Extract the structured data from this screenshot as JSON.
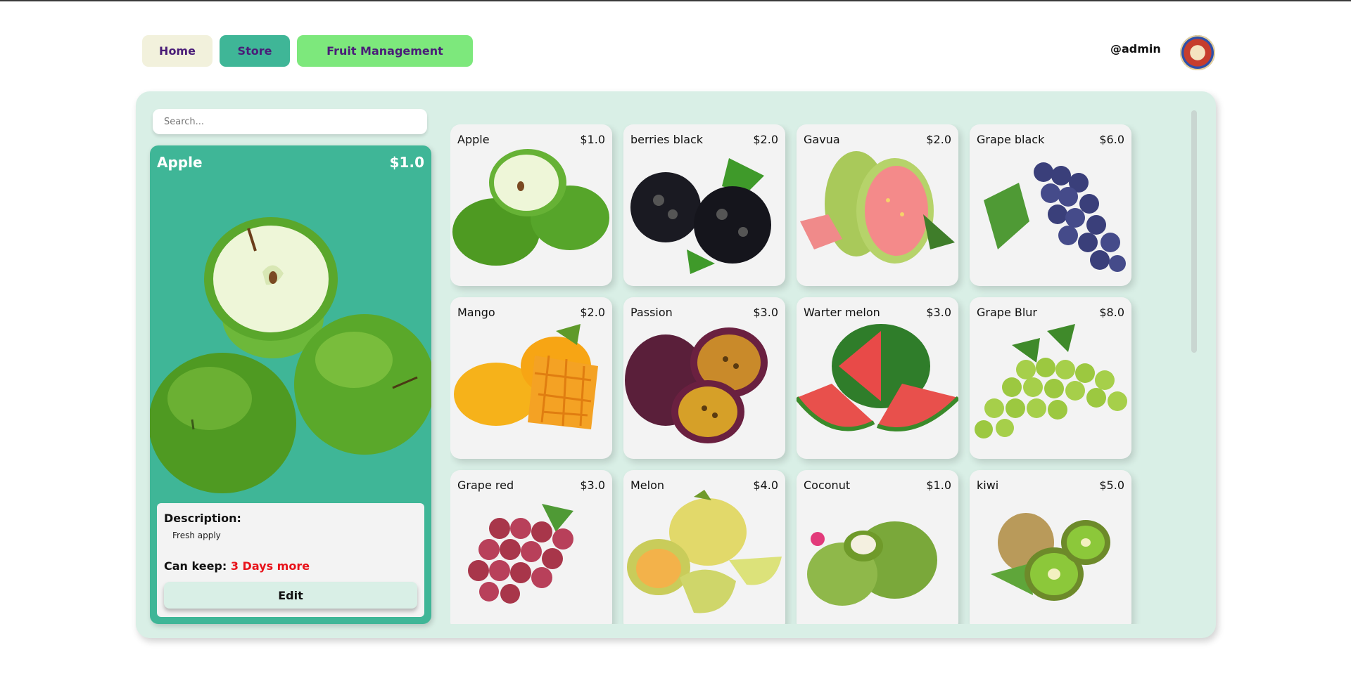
{
  "nav": {
    "home_label": "Home",
    "store_label": "Store",
    "fruit_management_label": "Fruit Management",
    "username": "@admin",
    "avatar_icon": "seal-emblem-icon"
  },
  "search": {
    "placeholder": "Search..."
  },
  "detail": {
    "name": "Apple",
    "price": "$1.0",
    "image_icon": "apple-icon",
    "description_label": "Description:",
    "description": "Fresh apply",
    "keep_label": "Can keep:",
    "keep_value": "3 Days more",
    "edit_label": "Edit"
  },
  "fruits": [
    {
      "name": "Apple",
      "price": "$1.0",
      "icon": "green-apple-icon"
    },
    {
      "name": "berries black",
      "price": "$2.0",
      "icon": "blackberry-icon"
    },
    {
      "name": "Gavua",
      "price": "$2.0",
      "icon": "guava-icon"
    },
    {
      "name": "Grape black",
      "price": "$6.0",
      "icon": "black-grape-icon"
    },
    {
      "name": "Mango",
      "price": "$2.0",
      "icon": "mango-icon"
    },
    {
      "name": "Passion",
      "price": "$3.0",
      "icon": "passion-fruit-icon"
    },
    {
      "name": "Warter melon",
      "price": "$3.0",
      "icon": "watermelon-icon"
    },
    {
      "name": "Grape Blur",
      "price": "$8.0",
      "icon": "green-grape-icon"
    },
    {
      "name": "Grape red",
      "price": "$3.0",
      "icon": "red-grape-icon"
    },
    {
      "name": "Melon",
      "price": "$4.0",
      "icon": "melon-icon"
    },
    {
      "name": "Coconut",
      "price": "$1.0",
      "icon": "coconut-icon"
    },
    {
      "name": "kiwi",
      "price": "$5.0",
      "icon": "kiwi-icon"
    }
  ],
  "colors": {
    "panel_bg": "#d9efe6",
    "detail_bg": "#3fb697",
    "nav_home": "#f2f1dc",
    "nav_store": "#3fb697",
    "nav_fruit": "#7de87c",
    "keep_value": "#e8121a",
    "nav_text": "#4a1d78"
  }
}
